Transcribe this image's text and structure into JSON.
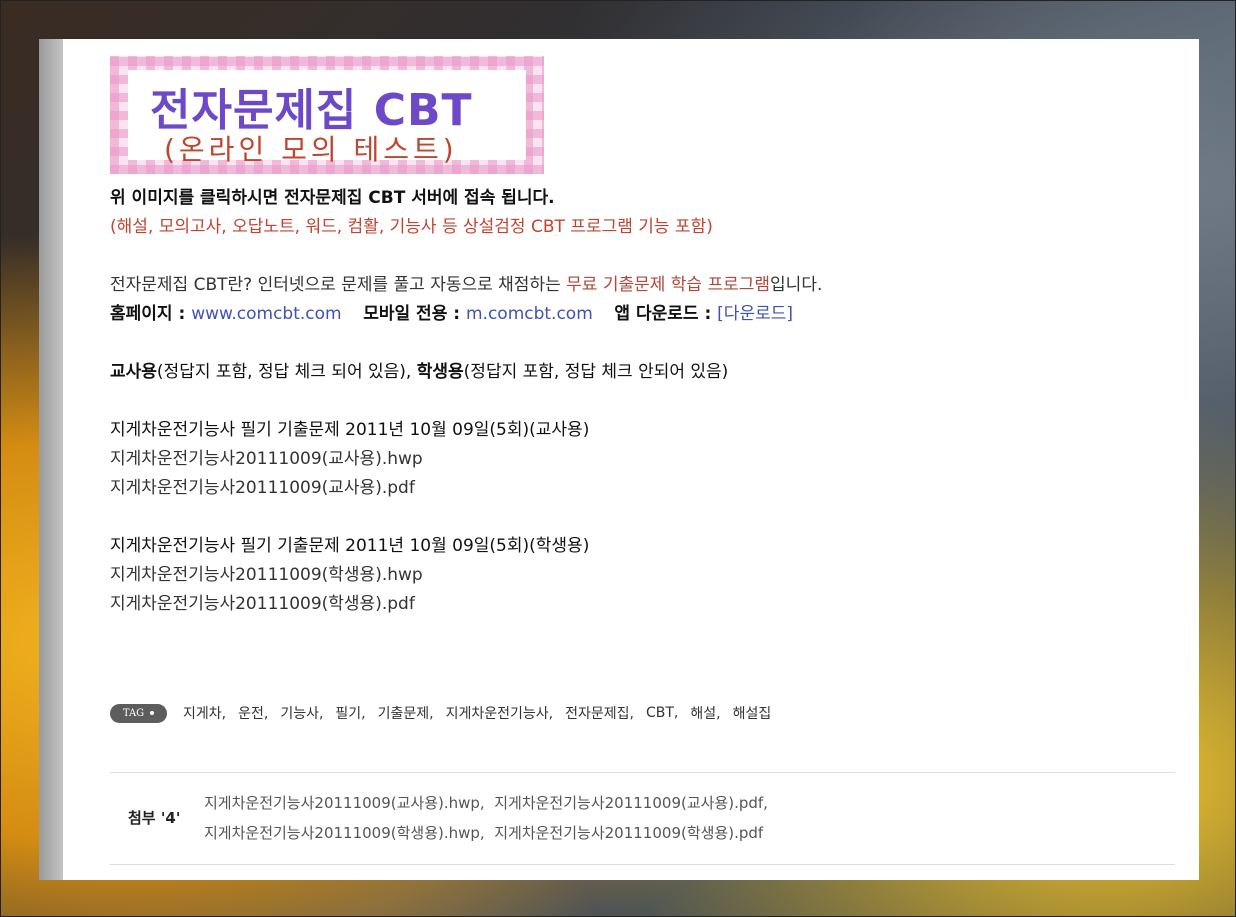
{
  "banner": {
    "title": "전자문제집 CBT",
    "subtitle": "(온라인 모의 테스트)"
  },
  "intro": {
    "click_notice": "위 이미지를 클릭하시면 전자문제집 CBT 서버에 접속 됩니다.",
    "features": "(해설, 모의고사, 오답노트, 워드, 컴활, 기능사 등 상설검정 CBT 프로그램 기능 포함)",
    "desc_prefix": "전자문제집 CBT란? 인터넷으로 문제를 풀고 자동으로 채점하는 ",
    "desc_highlight": "무료 기출문제 학습 프로그램",
    "desc_suffix": "입니다."
  },
  "links": {
    "home_label": "홈페이지 : ",
    "home_url": "www.comcbt.com",
    "mobile_label": "모바일 전용 : ",
    "mobile_url": "m.comcbt.com",
    "app_label": "앱 다운로드 : ",
    "app_link": "[다운로드]"
  },
  "usage": {
    "teacher_label": "교사용",
    "teacher_desc": "(정답지 포함, 정답 체크 되어 있음), ",
    "student_label": "학생용",
    "student_desc": "(정답지 포함, 정답 체크 안되어 있음)"
  },
  "sections": [
    {
      "heading": "지게차운전기능사 필기 기출문제 2011년 10월 09일(5회)(교사용)",
      "files": [
        "지게차운전기능사20111009(교사용).hwp",
        "지게차운전기능사20111009(교사용).pdf"
      ]
    },
    {
      "heading": "지게차운전기능사 필기 기출문제 2011년 10월 09일(5회)(학생용)",
      "files": [
        "지게차운전기능사20111009(학생용).hwp",
        "지게차운전기능사20111009(학생용).pdf"
      ]
    }
  ],
  "tags": {
    "badge": "TAG",
    "items": [
      "지게차,",
      "운전,",
      "기능사,",
      "필기,",
      "기출문제,",
      "지게차운전기능사,",
      "전자문제집,",
      "CBT,",
      "해설,",
      "해설집"
    ]
  },
  "attachments": {
    "label": "첨부 '4'",
    "row1": [
      "지게차운전기능사20111009(교사용).hwp,",
      "지게차운전기능사20111009(교사용).pdf,"
    ],
    "row2": [
      "지게차운전기능사20111009(학생용).hwp,",
      "지게차운전기능사20111009(학생용).pdf"
    ]
  }
}
